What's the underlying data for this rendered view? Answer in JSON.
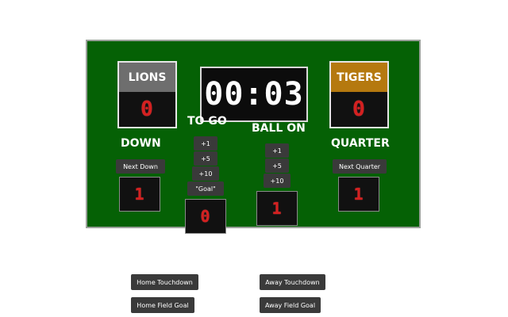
{
  "home": {
    "name": "LIONS",
    "score": "0",
    "name_bg": "#6e6e6e"
  },
  "away": {
    "name": "TIGERS",
    "score": "0",
    "name_bg": "#b5790f"
  },
  "clock": "00:03",
  "labels": {
    "to_go": "TO GO",
    "ball_on": "BALL ON",
    "down": "DOWN",
    "quarter": "QUARTER"
  },
  "down": {
    "button": "Next Down",
    "value": "1"
  },
  "quarter": {
    "button": "Next Quarter",
    "value": "1"
  },
  "to_go": {
    "buttons": [
      "+1",
      "+5",
      "+10",
      "\"Goal\""
    ],
    "value": "0"
  },
  "ball_on": {
    "buttons": [
      "+1",
      "+5",
      "+10"
    ],
    "value": "1"
  },
  "controls": {
    "home_touchdown": "Home Touchdown",
    "away_touchdown": "Away Touchdown",
    "home_field_goal": "Home Field Goal",
    "away_field_goal": "Away Field Goal"
  }
}
